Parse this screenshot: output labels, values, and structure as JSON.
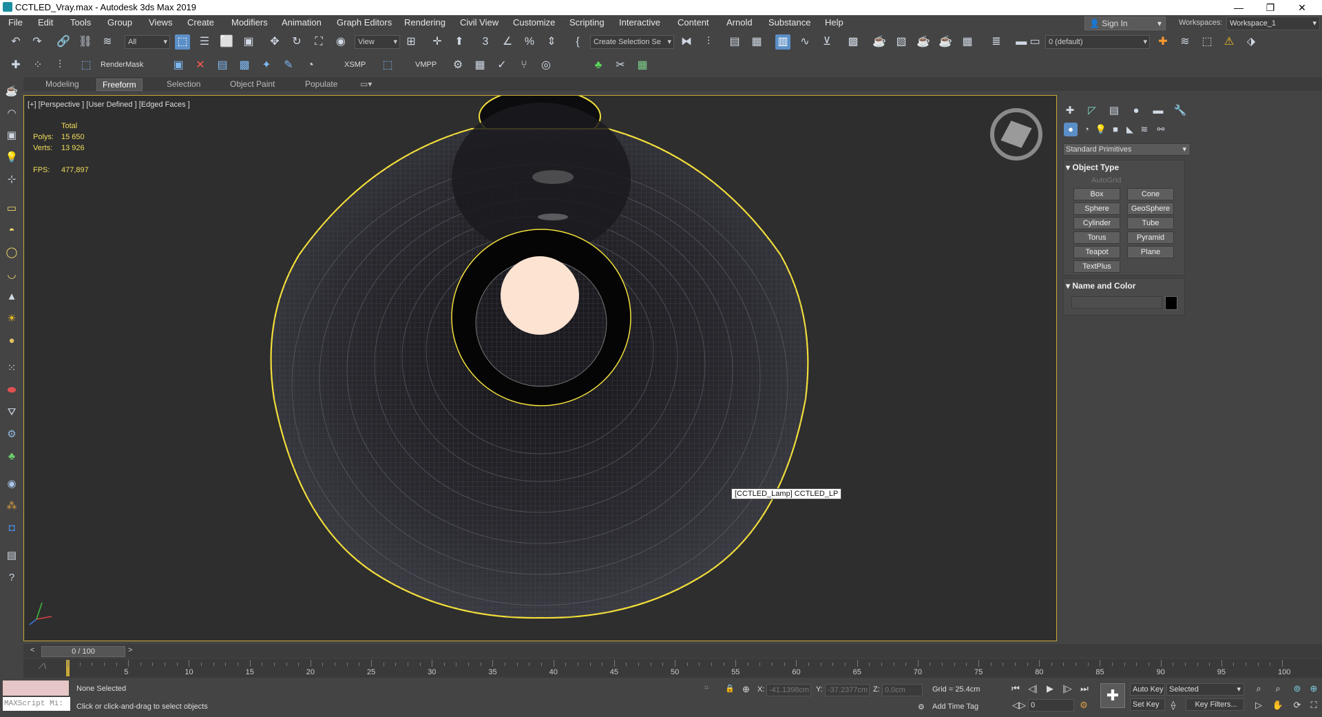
{
  "title": "CCTLED_Vray.max - Autodesk 3ds Max 2019",
  "menus": [
    "File",
    "Edit",
    "Tools",
    "Group",
    "Views",
    "Create",
    "Modifiers",
    "Animation",
    "Graph Editors",
    "Rendering",
    "Civil View",
    "Customize",
    "Scripting",
    "Interactive",
    "Content",
    "Arnold",
    "Substance",
    "Help"
  ],
  "account": {
    "sign_in": "Sign In",
    "workspaces_label": "Workspaces:",
    "workspace": "Workspace_1"
  },
  "toolbar": {
    "filter": "All",
    "ref_coord": "View",
    "selection_set": "Create Selection Se",
    "layer": "0 (default)",
    "render_mask": "RenderMask",
    "rb": "RB",
    "xsmp": "XSMP",
    "vmpp": "VMPP",
    "fp": "FP"
  },
  "ribbon_tabs": [
    "Modeling",
    "Freeform",
    "Selection",
    "Object Paint",
    "Populate"
  ],
  "viewport": {
    "label": "[+] [Perspective ] [User Defined ] [Edged Faces ]",
    "stats": {
      "total": "Total",
      "polys_label": "Polys:",
      "polys": "15 650",
      "verts_label": "Verts:",
      "verts": "13 926",
      "fps_label": "FPS:",
      "fps": "477,897"
    },
    "tooltip": "[CCTLED_Lamp]  CCTLED_LP"
  },
  "command_panel": {
    "category": "Standard Primitives",
    "object_type_title": "Object Type",
    "autogrid": "AutoGrid",
    "buttons": [
      "Box",
      "Cone",
      "Sphere",
      "GeoSphere",
      "Cylinder",
      "Tube",
      "Torus",
      "Pyramid",
      "Teapot",
      "Plane",
      "TextPlus"
    ],
    "name_color_title": "Name and Color",
    "swatch_color": "#000000"
  },
  "timeline": {
    "slider": "0 / 100",
    "ticks": [
      "5",
      "10",
      "15",
      "20",
      "25",
      "30",
      "35",
      "40",
      "45",
      "50",
      "55",
      "60",
      "65",
      "70",
      "75",
      "80",
      "85",
      "90",
      "95",
      "100"
    ]
  },
  "status": {
    "script_field": "MAXScript Mi:",
    "selection": "None Selected",
    "prompt": "Click or click-and-drag to select objects",
    "x_label": "X:",
    "x": "-41.1398cm",
    "y_label": "Y:",
    "y": "-37.2377cm",
    "z_label": "Z:",
    "z": "0.0cm",
    "grid": "Grid = 25.4cm",
    "add_time_tag": "Add Time Tag",
    "auto_key": "Auto Key",
    "set_key": "Set Key",
    "selected": "Selected",
    "key_filters": "Key Filters...",
    "frame": "0"
  },
  "colors": {
    "selection_yellow": "#f5e13a",
    "active_blue": "#5b8fc7"
  }
}
